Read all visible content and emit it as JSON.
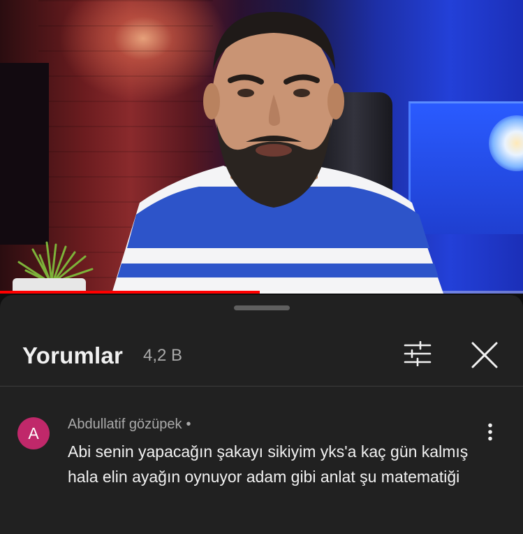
{
  "video": {
    "progress_percent": 49.6,
    "accent_color": "#ff0000"
  },
  "comments_panel": {
    "title": "Yorumlar",
    "count": "4,2 B",
    "filter_icon": "sliders-icon",
    "close_icon": "close-icon"
  },
  "comment": {
    "avatar_letter": "A",
    "avatar_color": "#c0286a",
    "author": "Abdullatif gözüpek",
    "separator": "•",
    "text": "Abi senin yapacağın şakayı sikiyim yks'a kaç gün kalmış hala elin ayağın oynuyor adam gibi anlat şu matematiği",
    "menu_icon": "more-vertical-icon"
  }
}
